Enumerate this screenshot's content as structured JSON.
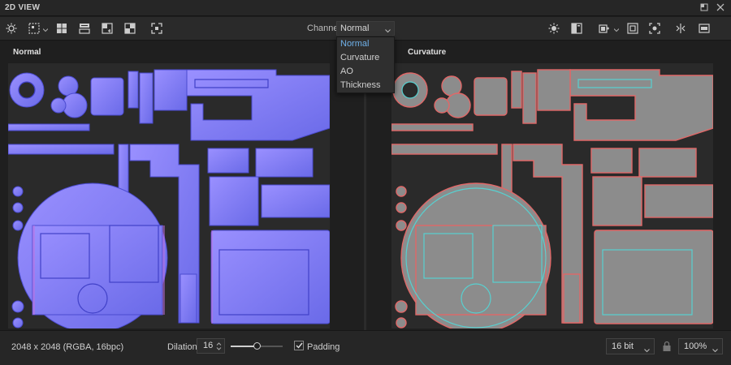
{
  "window": {
    "title": "2D VIEW"
  },
  "toolbar": {
    "left_icons": [
      "sun-icon",
      "grid-select-icon",
      "layout-grid-icon",
      "layout-split-icon",
      "layout-swap-icon",
      "layout-split-alt-icon",
      "layout-corners-icon"
    ],
    "channel_label": "Channel",
    "channel_value": "Normal",
    "right_icons": [
      "sun-icon",
      "panel-icon",
      "export-icon",
      "fit-view-icon",
      "focus-icon",
      "compare-icon",
      "window-icon"
    ]
  },
  "channel_dropdown": {
    "options": [
      "Normal",
      "Curvature",
      "AO",
      "Thickness"
    ],
    "selected_index": 0
  },
  "panes": {
    "left": {
      "title": "Normal",
      "texture": "normal-map",
      "tint": "#7b7bf0"
    },
    "right": {
      "title": "Curvature",
      "texture": "curvature-map",
      "tint": "#8a8a8a"
    }
  },
  "status": {
    "resolution": "2048 x 2048 (RGBA, 16bpc)",
    "dilation_label": "Dilation",
    "dilation_value": "16",
    "dilation_slider_fraction": 0.5,
    "padding_label": "Padding",
    "padding_checked": true,
    "bit_depth": "16 bit",
    "zoom": "100%"
  },
  "colors": {
    "accent": "#6fb0e8",
    "normal_base": "#7b7bf0",
    "curvature_base": "#8a8a8a",
    "curvature_edge": "#e05050",
    "curvature_edge_cool": "#50d0d0"
  }
}
